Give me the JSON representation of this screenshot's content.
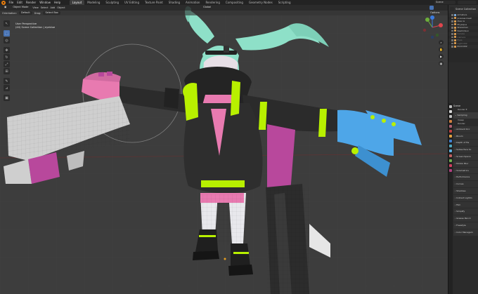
{
  "menubar": {
    "menus": [
      "File",
      "Edit",
      "Render",
      "Window",
      "Help"
    ],
    "workspaces": [
      "Layout",
      "Modeling",
      "Sculpting",
      "UV Editing",
      "Texture Paint",
      "Shading",
      "Animation",
      "Rendering",
      "Compositing",
      "Geometry Nodes",
      "Scripting"
    ],
    "scene_label": "Scene"
  },
  "viewport": {
    "mode": "Object Mode",
    "menus": [
      "View",
      "Select",
      "Add",
      "Object"
    ],
    "shading": "Global",
    "orientation_label": "Orientation:",
    "orientation_value": "Default",
    "drag_label": "Drag:",
    "drag_value": "Select Box",
    "options_label": "Options",
    "info_line1": "User Perspective",
    "info_line2": "(40) Scene Collection | eyeblue"
  },
  "outliner": {
    "title": "Scene Collection",
    "rows": [
      {
        "label": "armature",
        "color": "#7fb4e8",
        "dim": false
      },
      {
        "label": "preview.mesh",
        "color": "#e0a050",
        "dim": false
      },
      {
        "label": "Idea ra",
        "color": "#e0a050",
        "dim": false
      },
      {
        "label": "Physique",
        "color": "#e0a050",
        "dim": false
      },
      {
        "label": "Sharemen",
        "color": "#e0a050",
        "dim": false
      },
      {
        "label": "Realm/Gun",
        "color": "#e0a050",
        "dim": false
      },
      {
        "label": "Curves",
        "color": "#e0a050",
        "dim": true
      },
      {
        "label": "Camera",
        "color": "#e0a050",
        "dim": true
      },
      {
        "label": "Eyes",
        "color": "#e0a050",
        "dim": true
      },
      {
        "label": "Light.002",
        "color": "#e0a050",
        "dim": true
      },
      {
        "label": "Point.002",
        "color": "#e0a050",
        "dim": false
      }
    ]
  },
  "properties": {
    "tab_title": "Scene",
    "render_field": "Render E",
    "sampling": "Sampling",
    "fields": [
      "Viewp",
      "Render"
    ],
    "sections": [
      "Ambient Occ",
      "Bloom",
      "Depth of Fie",
      "Subsurface Sc",
      "Screen Space",
      "Motion Blur",
      "Volumetrics",
      "Performance",
      "Curves",
      "Shadows",
      "Indirect Lightin",
      "Film",
      "Simplify",
      "Grease Pencil",
      "Freestyle",
      "Color Managem"
    ]
  },
  "colors": {
    "accent": "#4772b3",
    "grid_bg": "#3d3d3d",
    "hair": "#8ee0c8",
    "jacket": "#2a2a2a",
    "neon": "#b8f000",
    "pink": "#e87ab0",
    "gun_grey": "#cfcfcf",
    "gun_purple": "#b8489c",
    "glove_blue": "#4ea6e8"
  },
  "icons": {
    "tools": [
      "cursor-icon",
      "select-box-icon",
      "move-icon",
      "rotate-icon",
      "scale-icon",
      "transform-icon",
      "annotate-icon",
      "measure-icon",
      "add-cube-icon"
    ]
  }
}
